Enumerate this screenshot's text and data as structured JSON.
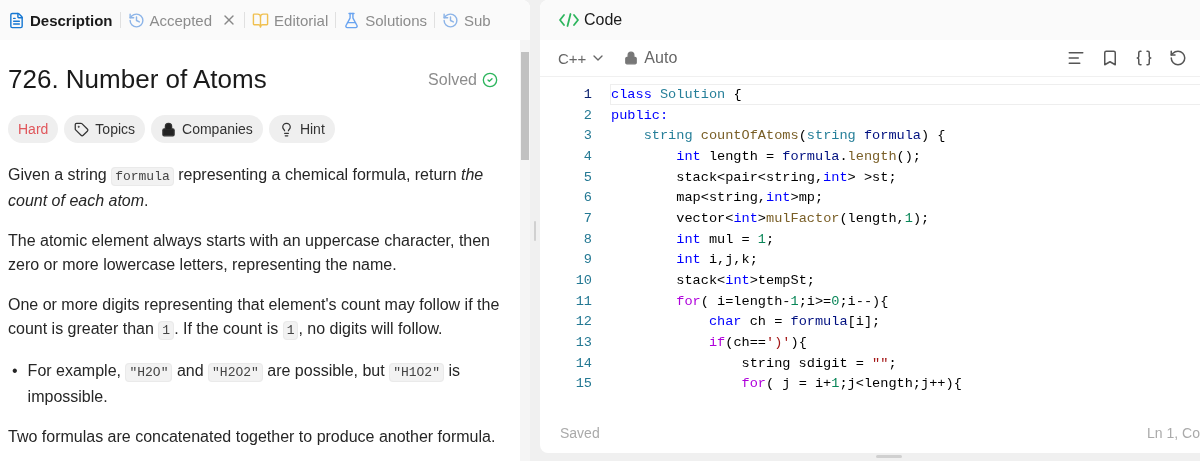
{
  "tabs": [
    {
      "kind": "description",
      "label": "Description",
      "selected": true,
      "closable": false
    },
    {
      "kind": "accepted",
      "label": "Accepted",
      "selected": false,
      "closable": true
    },
    {
      "kind": "editorial",
      "label": "Editorial",
      "selected": false,
      "closable": false
    },
    {
      "kind": "solutions",
      "label": "Solutions",
      "selected": false,
      "closable": false
    },
    {
      "kind": "submissions",
      "label": "Sub",
      "selected": false,
      "closable": false
    }
  ],
  "problem": {
    "title": "726. Number of Atoms",
    "status": "Solved",
    "tags": [
      {
        "kind": "difficulty",
        "label": "Hard"
      },
      {
        "kind": "topics",
        "label": "Topics"
      },
      {
        "kind": "companies",
        "label": "Companies"
      },
      {
        "kind": "hint",
        "label": "Hint"
      }
    ],
    "paragraphs": [
      {
        "kind": "paragraph",
        "segments": [
          {
            "kind": "text",
            "text": "Given a string "
          },
          {
            "kind": "code",
            "text": "formula"
          },
          {
            "kind": "text",
            "text": " representing a chemical formula, return "
          },
          {
            "kind": "italic",
            "text": "the count of each atom"
          },
          {
            "kind": "text",
            "text": "."
          }
        ]
      },
      {
        "kind": "paragraph",
        "segments": [
          {
            "kind": "text",
            "text": "The atomic element always starts with an uppercase character, then zero or more lowercase letters, representing the name."
          }
        ]
      },
      {
        "kind": "paragraph",
        "segments": [
          {
            "kind": "text",
            "text": "One or more digits representing that element's count may follow if the count is greater than "
          },
          {
            "kind": "code",
            "text": "1"
          },
          {
            "kind": "text",
            "text": ". If the count is "
          },
          {
            "kind": "code",
            "text": "1"
          },
          {
            "kind": "text",
            "text": ", no digits will follow."
          }
        ]
      },
      {
        "kind": "bullet",
        "marker": "•",
        "segments": [
          {
            "kind": "text",
            "text": "For example, "
          },
          {
            "kind": "code",
            "text": "\"H2O\""
          },
          {
            "kind": "text",
            "text": " and "
          },
          {
            "kind": "code",
            "text": "\"H2O2\""
          },
          {
            "kind": "text",
            "text": " are possible, but "
          },
          {
            "kind": "code",
            "text": "\"H1O2\""
          },
          {
            "kind": "text",
            "text": " is impossible."
          }
        ]
      },
      {
        "kind": "paragraph",
        "segments": [
          {
            "kind": "text",
            "text": "Two formulas are concatenated together to produce another formula."
          }
        ]
      }
    ]
  },
  "editor": {
    "title": "Code",
    "language": "C++",
    "mode": "Auto",
    "status": "Saved",
    "cursor": "Ln 1, Co",
    "lines": [
      {
        "number": "1",
        "current": true,
        "tokens": [
          {
            "kind": "kw",
            "text": "class"
          },
          {
            "kind": "type",
            "text": " Solution"
          },
          {
            "kind": "plain",
            "text": " {"
          }
        ]
      },
      {
        "number": "2",
        "current": false,
        "tokens": [
          {
            "kind": "kw",
            "text": "public:"
          }
        ]
      },
      {
        "number": "3",
        "current": false,
        "tokens": [
          {
            "kind": "type",
            "text": "    string"
          },
          {
            "kind": "fn",
            "text": " countOfAtoms"
          },
          {
            "kind": "plain",
            "text": "("
          },
          {
            "kind": "type",
            "text": "string"
          },
          {
            "kind": "var",
            "text": " formula"
          },
          {
            "kind": "plain",
            "text": ") {"
          }
        ]
      },
      {
        "number": "4",
        "current": false,
        "tokens": [
          {
            "kind": "kw",
            "text": "        int"
          },
          {
            "kind": "plain",
            "text": " length = "
          },
          {
            "kind": "var",
            "text": "formula"
          },
          {
            "kind": "plain",
            "text": "."
          },
          {
            "kind": "fn",
            "text": "length"
          },
          {
            "kind": "plain",
            "text": "();"
          }
        ]
      },
      {
        "number": "5",
        "current": false,
        "tokens": [
          {
            "kind": "plain",
            "text": "        stack<pair<string,"
          },
          {
            "kind": "kw",
            "text": "int"
          },
          {
            "kind": "plain",
            "text": "> >st;"
          }
        ]
      },
      {
        "number": "6",
        "current": false,
        "tokens": [
          {
            "kind": "plain",
            "text": "        map<string,"
          },
          {
            "kind": "kw",
            "text": "int"
          },
          {
            "kind": "plain",
            "text": ">mp;"
          }
        ]
      },
      {
        "number": "7",
        "current": false,
        "tokens": [
          {
            "kind": "plain",
            "text": "        vector<"
          },
          {
            "kind": "kw",
            "text": "int"
          },
          {
            "kind": "plain",
            "text": ">"
          },
          {
            "kind": "fn",
            "text": "mulFactor"
          },
          {
            "kind": "plain",
            "text": "(length,"
          },
          {
            "kind": "num",
            "text": "1"
          },
          {
            "kind": "plain",
            "text": ");"
          }
        ]
      },
      {
        "number": "8",
        "current": false,
        "tokens": [
          {
            "kind": "kw",
            "text": "        int"
          },
          {
            "kind": "plain",
            "text": " mul = "
          },
          {
            "kind": "num",
            "text": "1"
          },
          {
            "kind": "plain",
            "text": ";"
          }
        ]
      },
      {
        "number": "9",
        "current": false,
        "tokens": [
          {
            "kind": "kw",
            "text": "        int"
          },
          {
            "kind": "plain",
            "text": " i,j,k;"
          }
        ]
      },
      {
        "number": "10",
        "current": false,
        "tokens": [
          {
            "kind": "plain",
            "text": "        stack<"
          },
          {
            "kind": "kw",
            "text": "int"
          },
          {
            "kind": "plain",
            "text": ">tempSt;"
          }
        ]
      },
      {
        "number": "11",
        "current": false,
        "tokens": [
          {
            "kind": "ctrl",
            "text": "        for"
          },
          {
            "kind": "plain",
            "text": "( i=length-"
          },
          {
            "kind": "num",
            "text": "1"
          },
          {
            "kind": "plain",
            "text": ";i>="
          },
          {
            "kind": "num",
            "text": "0"
          },
          {
            "kind": "plain",
            "text": ";i--){"
          }
        ]
      },
      {
        "number": "12",
        "current": false,
        "tokens": [
          {
            "kind": "kw",
            "text": "            char"
          },
          {
            "kind": "plain",
            "text": " ch = "
          },
          {
            "kind": "var",
            "text": "formula"
          },
          {
            "kind": "plain",
            "text": "[i];"
          }
        ]
      },
      {
        "number": "13",
        "current": false,
        "tokens": [
          {
            "kind": "ctrl",
            "text": "            if"
          },
          {
            "kind": "plain",
            "text": "(ch=="
          },
          {
            "kind": "str",
            "text": "')'"
          },
          {
            "kind": "plain",
            "text": "){"
          }
        ]
      },
      {
        "number": "14",
        "current": false,
        "tokens": [
          {
            "kind": "plain",
            "text": "                string sdigit = "
          },
          {
            "kind": "str",
            "text": "\"\""
          },
          {
            "kind": "plain",
            "text": ";"
          }
        ]
      },
      {
        "number": "15",
        "current": false,
        "tokens": [
          {
            "kind": "ctrl",
            "text": "                for"
          },
          {
            "kind": "plain",
            "text": "( j = i+"
          },
          {
            "kind": "num",
            "text": "1"
          },
          {
            "kind": "plain",
            "text": ";j<length;j++){"
          }
        ]
      }
    ]
  }
}
